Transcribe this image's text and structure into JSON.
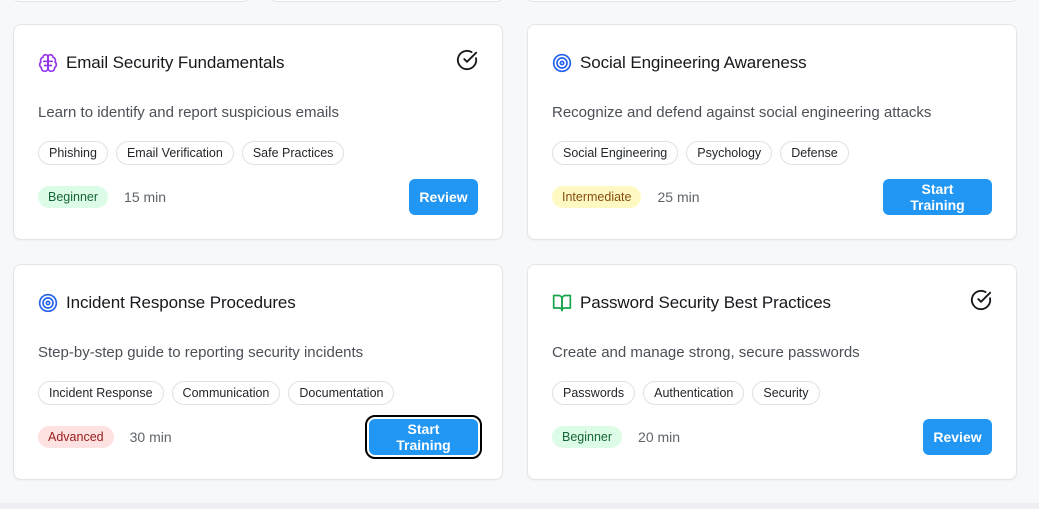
{
  "cards": [
    {
      "title": "Email Security Fundamentals",
      "icon": "brain-icon",
      "completed": true,
      "description": "Learn to identify and report suspicious emails",
      "tags": [
        "Phishing",
        "Email Verification",
        "Safe Practices"
      ],
      "level": "Beginner",
      "duration": "15 min",
      "action": "Review"
    },
    {
      "title": "Social Engineering Awareness",
      "icon": "target-icon",
      "completed": false,
      "description": "Recognize and defend against social engineering attacks",
      "tags": [
        "Social Engineering",
        "Psychology",
        "Defense"
      ],
      "level": "Intermediate",
      "duration": "25 min",
      "action": "Start Training"
    },
    {
      "title": "Incident Response Procedures",
      "icon": "target-icon",
      "completed": false,
      "description": "Step-by-step guide to reporting security incidents",
      "tags": [
        "Incident Response",
        "Communication",
        "Documentation"
      ],
      "level": "Advanced",
      "duration": "30 min",
      "action": "Start Training"
    },
    {
      "title": "Password Security Best Practices",
      "icon": "book-open-icon",
      "completed": true,
      "description": "Create and manage strong, secure passwords",
      "tags": [
        "Passwords",
        "Authentication",
        "Security"
      ],
      "level": "Beginner",
      "duration": "20 min",
      "action": "Review"
    }
  ],
  "colors": {
    "accent": "#2196f3",
    "beginner_bg": "#dcfce7",
    "intermediate_bg": "#fef9c3",
    "advanced_bg": "#fee2e2",
    "brain_icon": "#9333ea",
    "target_icon": "#2563eb",
    "book_icon": "#16a34a"
  }
}
